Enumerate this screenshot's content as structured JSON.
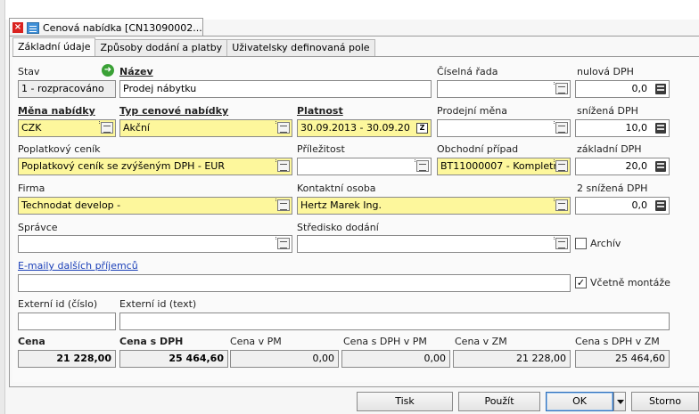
{
  "tab": {
    "title": "Cenová nabídka [CN13090002..."
  },
  "subtabs": [
    "Základní údaje",
    "Způsoby dodání a platby",
    "Uživatelsky definovaná pole"
  ],
  "form": {
    "stav": {
      "label": "Stav",
      "value": "1 - rozpracováno"
    },
    "nazev": {
      "label": "Název",
      "value": "Prodej nábytku"
    },
    "ciselna_rada": {
      "label": "Číselná řada",
      "value": ""
    },
    "nulova_dph": {
      "label": "nulová DPH",
      "value": "0,0"
    },
    "mena": {
      "label": "Měna nabídky",
      "value": "CZK"
    },
    "typ": {
      "label": "Typ cenové nabídky",
      "value": "Akční"
    },
    "platnost": {
      "label": "Platnost",
      "value": "30.09.2013 - 30.09.20",
      "cal": "Z"
    },
    "prodejni_mena": {
      "label": "Prodejní měna",
      "value": ""
    },
    "snizena_dph": {
      "label": "snížená DPH",
      "value": "10,0"
    },
    "poplatkovy_cenik": {
      "label": "Poplatkový ceník",
      "value": "Poplatkový ceník se zvýšeným DPH - EUR"
    },
    "prilezitost": {
      "label": "Příležitost",
      "value": ""
    },
    "obchodni_pripad": {
      "label": "Obchodní případ",
      "value": "BT11000007 - Kompletr"
    },
    "zakladni_dph": {
      "label": "základní DPH",
      "value": "20,0"
    },
    "firma": {
      "label": "Firma",
      "value": "Technodat develop -"
    },
    "kontaktni_osoba": {
      "label": "Kontaktní osoba",
      "value": "Hertz Marek Ing."
    },
    "snizena2_dph": {
      "label": "2 snížená DPH",
      "value": "0,0"
    },
    "spravce": {
      "label": "Správce",
      "value": ""
    },
    "stredisko": {
      "label": "Středisko dodání",
      "value": ""
    },
    "archiv": {
      "label": "Archív",
      "checked": false
    },
    "emaily": {
      "label": "E-maily dalších příjemců",
      "value": ""
    },
    "vcetne_montaze": {
      "label": "Včetně montáže",
      "checked": true,
      "mark": "✓"
    },
    "ext_id_cislo": {
      "label": "Externí id (číslo)",
      "value": ""
    },
    "ext_id_text": {
      "label": "Externí id (text)",
      "value": ""
    }
  },
  "totals": {
    "cena": {
      "label": "Cena",
      "value": "21 228,00"
    },
    "cena_dph": {
      "label": "Cena s DPH",
      "value": "25 464,60"
    },
    "cena_pm": {
      "label": "Cena v PM",
      "value": "0,00"
    },
    "cena_dph_pm": {
      "label": "Cena s DPH v PM",
      "value": "0,00"
    },
    "cena_zm": {
      "label": "Cena v ZM",
      "value": "21 228,00"
    },
    "cena_dph_zm": {
      "label": "Cena s DPH v ZM",
      "value": "25 464,60"
    }
  },
  "buttons": {
    "tisk": "Tisk",
    "pouzit": "Použít",
    "ok": "OK",
    "storno": "Storno"
  },
  "icons": {
    "close": "×",
    "arrow": "➜"
  },
  "colors": {
    "required_field": "#fdf79c",
    "close_red": "#d9221f",
    "link": "#1a3fb8"
  }
}
